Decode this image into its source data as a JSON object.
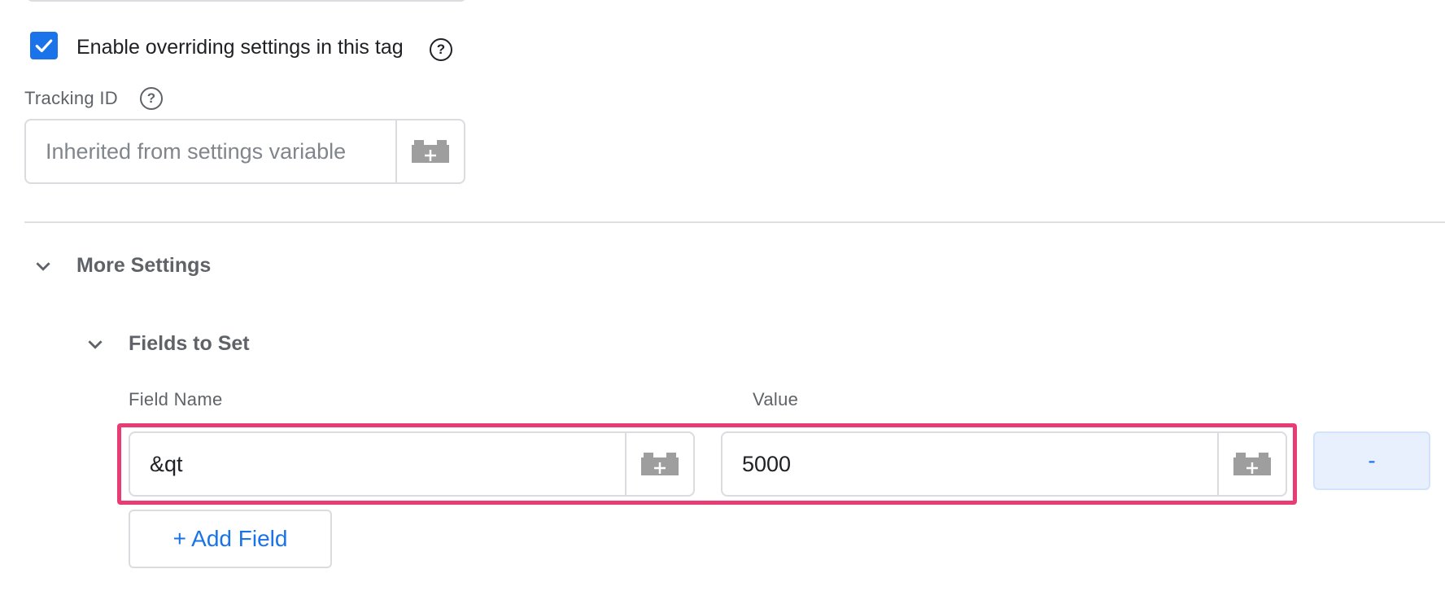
{
  "override": {
    "checked": true,
    "label": "Enable overriding settings in this tag",
    "help_icon": "question-circle-icon"
  },
  "tracking": {
    "label": "Tracking ID",
    "help_icon": "question-circle-icon",
    "placeholder": "Inherited from settings variable",
    "variable_icon": "variable-brick-plus-icon"
  },
  "more_settings": {
    "title": "More Settings",
    "chevron": "chevron-down-icon"
  },
  "fields_to_set": {
    "title": "Fields to Set",
    "chevron": "chevron-down-icon",
    "columns": {
      "name": "Field Name",
      "value": "Value"
    },
    "rows": [
      {
        "name": "&qt",
        "value": "5000"
      }
    ],
    "remove_label": "-",
    "add_label": "+ Add Field"
  },
  "colors": {
    "accent": "#1a73e8",
    "highlight": "#ea3c74",
    "remove_bg": "#e8f0fe"
  }
}
